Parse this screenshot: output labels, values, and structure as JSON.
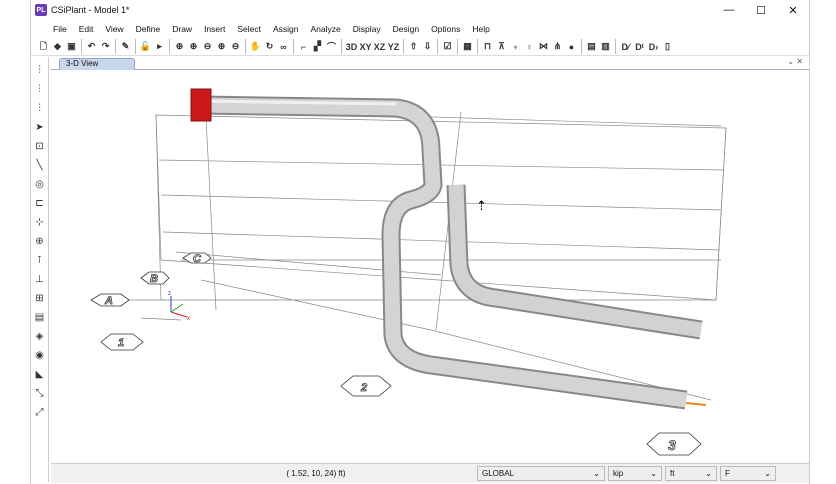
{
  "window": {
    "title": "CSiPlant - Model 1*",
    "app_icon": "PL",
    "controls": [
      "—",
      "☐",
      "✕"
    ]
  },
  "menu": [
    "File",
    "Edit",
    "View",
    "Define",
    "Draw",
    "Insert",
    "Select",
    "Assign",
    "Analyze",
    "Display",
    "Design",
    "Options",
    "Help"
  ],
  "toolbar": [
    {
      "name": "new-icon",
      "g": "🗋"
    },
    {
      "name": "open-icon",
      "g": "◆"
    },
    {
      "name": "save-icon",
      "g": "▣"
    },
    {
      "sep": true
    },
    {
      "name": "undo-icon",
      "g": "↶"
    },
    {
      "name": "redo-icon",
      "g": "↷"
    },
    {
      "sep": true
    },
    {
      "name": "pencil-icon",
      "g": "✎"
    },
    {
      "sep": true
    },
    {
      "name": "lock-icon",
      "g": "🔓"
    },
    {
      "name": "run-icon",
      "g": "▸"
    },
    {
      "sep": true
    },
    {
      "name": "zoom-window-icon",
      "g": "⊕"
    },
    {
      "name": "zoom-all-icon",
      "g": "⊕"
    },
    {
      "name": "zoom-prev-icon",
      "g": "⊖"
    },
    {
      "name": "zoom-in-icon",
      "g": "⊕"
    },
    {
      "name": "zoom-out-icon",
      "g": "⊖"
    },
    {
      "sep": true
    },
    {
      "name": "pan-icon",
      "g": "✋"
    },
    {
      "name": "rotate-icon",
      "g": "↻"
    },
    {
      "name": "perspective-icon",
      "g": "∞"
    },
    {
      "sep": true
    },
    {
      "name": "extrude-icon",
      "g": "⌐"
    },
    {
      "name": "shade-icon",
      "g": "▞"
    },
    {
      "name": "curve-icon",
      "g": "⌒"
    },
    {
      "sep": true
    },
    {
      "name": "view-3d",
      "g": "3D"
    },
    {
      "name": "view-xy",
      "g": "XY"
    },
    {
      "name": "view-xz",
      "g": "XZ"
    },
    {
      "name": "view-yz",
      "g": "YZ"
    },
    {
      "sep": true
    },
    {
      "name": "up-icon",
      "g": "⇧"
    },
    {
      "name": "down-icon",
      "g": "⇩"
    },
    {
      "sep": true
    },
    {
      "name": "check-icon",
      "g": "☑"
    },
    {
      "sep": true
    },
    {
      "name": "grid-icon",
      "g": "▦"
    },
    {
      "sep": true
    },
    {
      "name": "frame-icon",
      "g": "⊓"
    },
    {
      "name": "support-icon",
      "g": "⊼"
    },
    {
      "name": "hanger-icon",
      "g": "♆"
    },
    {
      "name": "spring-icon",
      "g": "♀"
    },
    {
      "name": "joint-icon",
      "g": "⋈"
    },
    {
      "name": "valve-icon",
      "g": "⋔"
    },
    {
      "name": "sphere-icon",
      "g": "●"
    },
    {
      "sep": true
    },
    {
      "name": "display-icon",
      "g": "▤"
    },
    {
      "name": "table-icon",
      "g": "▥"
    },
    {
      "sep": true
    },
    {
      "name": "design-icon",
      "g": "D⁄"
    },
    {
      "name": "design-check-icon",
      "g": "Dᵗ"
    },
    {
      "name": "design-d-icon",
      "g": "D›"
    },
    {
      "name": "report-icon",
      "g": "▯"
    }
  ],
  "left_tools": [
    "⫶",
    "⫶",
    "⫶",
    "➤",
    "⊡",
    "╲",
    "◎",
    "⊏",
    "⊹",
    "⊕",
    "⊺",
    "⊥",
    "⊞",
    "▤",
    "◈",
    "◉",
    "◣",
    "⤡",
    "⤢"
  ],
  "tab": {
    "label": "3-D View",
    "controls": "⌄ ✕"
  },
  "grid_labels": {
    "a": "A",
    "b": "B",
    "c": "C",
    "one": "1",
    "two": "2",
    "three": "3"
  },
  "axes": {
    "x": "x",
    "z": "z"
  },
  "status": {
    "coords": "( 1.52, 10, 24) ft)",
    "coord_system": "GLOBAL",
    "force_unit": "kip",
    "length_unit": "ft",
    "temp_unit": "F"
  },
  "colors": {
    "flange": "#cc1a1a",
    "pipe": "#c4c4c4",
    "accent": "#6a3db8"
  }
}
